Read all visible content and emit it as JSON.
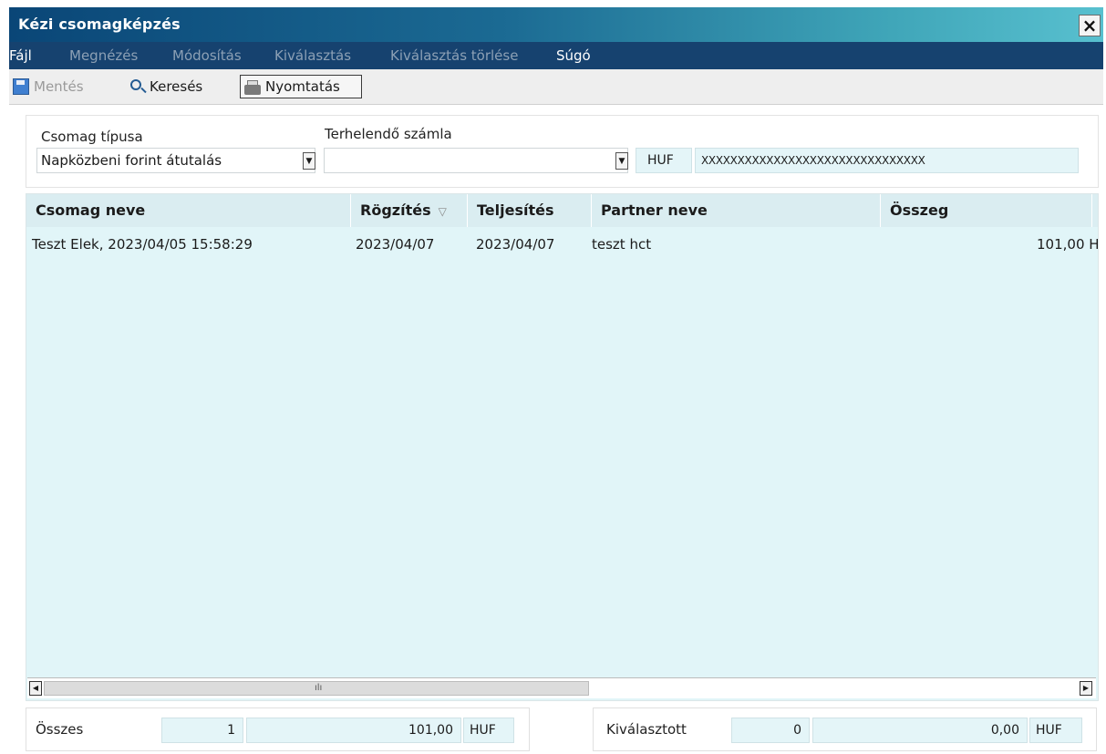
{
  "window": {
    "title": "Kézi csomagképzés",
    "close_label": "×"
  },
  "menu": [
    {
      "label": "Fájl",
      "enabled": true
    },
    {
      "label": "Megnézés",
      "enabled": false
    },
    {
      "label": "Módosítás",
      "enabled": false
    },
    {
      "label": "Kiválasztás",
      "enabled": false
    },
    {
      "label": "Kiválasztás törlése",
      "enabled": false
    },
    {
      "label": "Súgó",
      "enabled": true
    }
  ],
  "toolbar": {
    "save_label": "Mentés",
    "search_label": "Keresés",
    "print_label": "Nyomtatás"
  },
  "filter": {
    "package_type_label": "Csomag típusa",
    "package_type_value": "Napközbeni forint átutalás",
    "account_label": "Terhelendő számla",
    "account_value": "",
    "currency": "HUF",
    "account_number": "XXXXXXXXXXXXXXXXXXXXXXXXXXXXXXX"
  },
  "grid": {
    "columns": [
      "Csomag neve",
      "Rögzítés",
      "Teljesítés",
      "Partner neve",
      "Összeg"
    ],
    "sort_indicator": "▽",
    "rows": [
      {
        "name": "Teszt Elek, 2023/04/05 15:58:29",
        "recorded": "2023/04/07",
        "fulfilled": "2023/04/07",
        "partner": "teszt hct",
        "amount": "101,00 H"
      }
    ],
    "scroll_left_icon": "◀",
    "scroll_right_icon": "▶",
    "scroll_grip": "ılı"
  },
  "summary": {
    "total_label": "Összes",
    "total_count": "1",
    "total_amount": "101,00",
    "total_currency": "HUF",
    "selected_label": "Kiválasztott",
    "selected_count": "0",
    "selected_amount": "0,00",
    "selected_currency": "HUF"
  },
  "colors": {
    "title_start": "#0a4677",
    "title_end": "#58c0cf",
    "menubar": "#16426f",
    "grid_bg": "#e1f5f8"
  }
}
